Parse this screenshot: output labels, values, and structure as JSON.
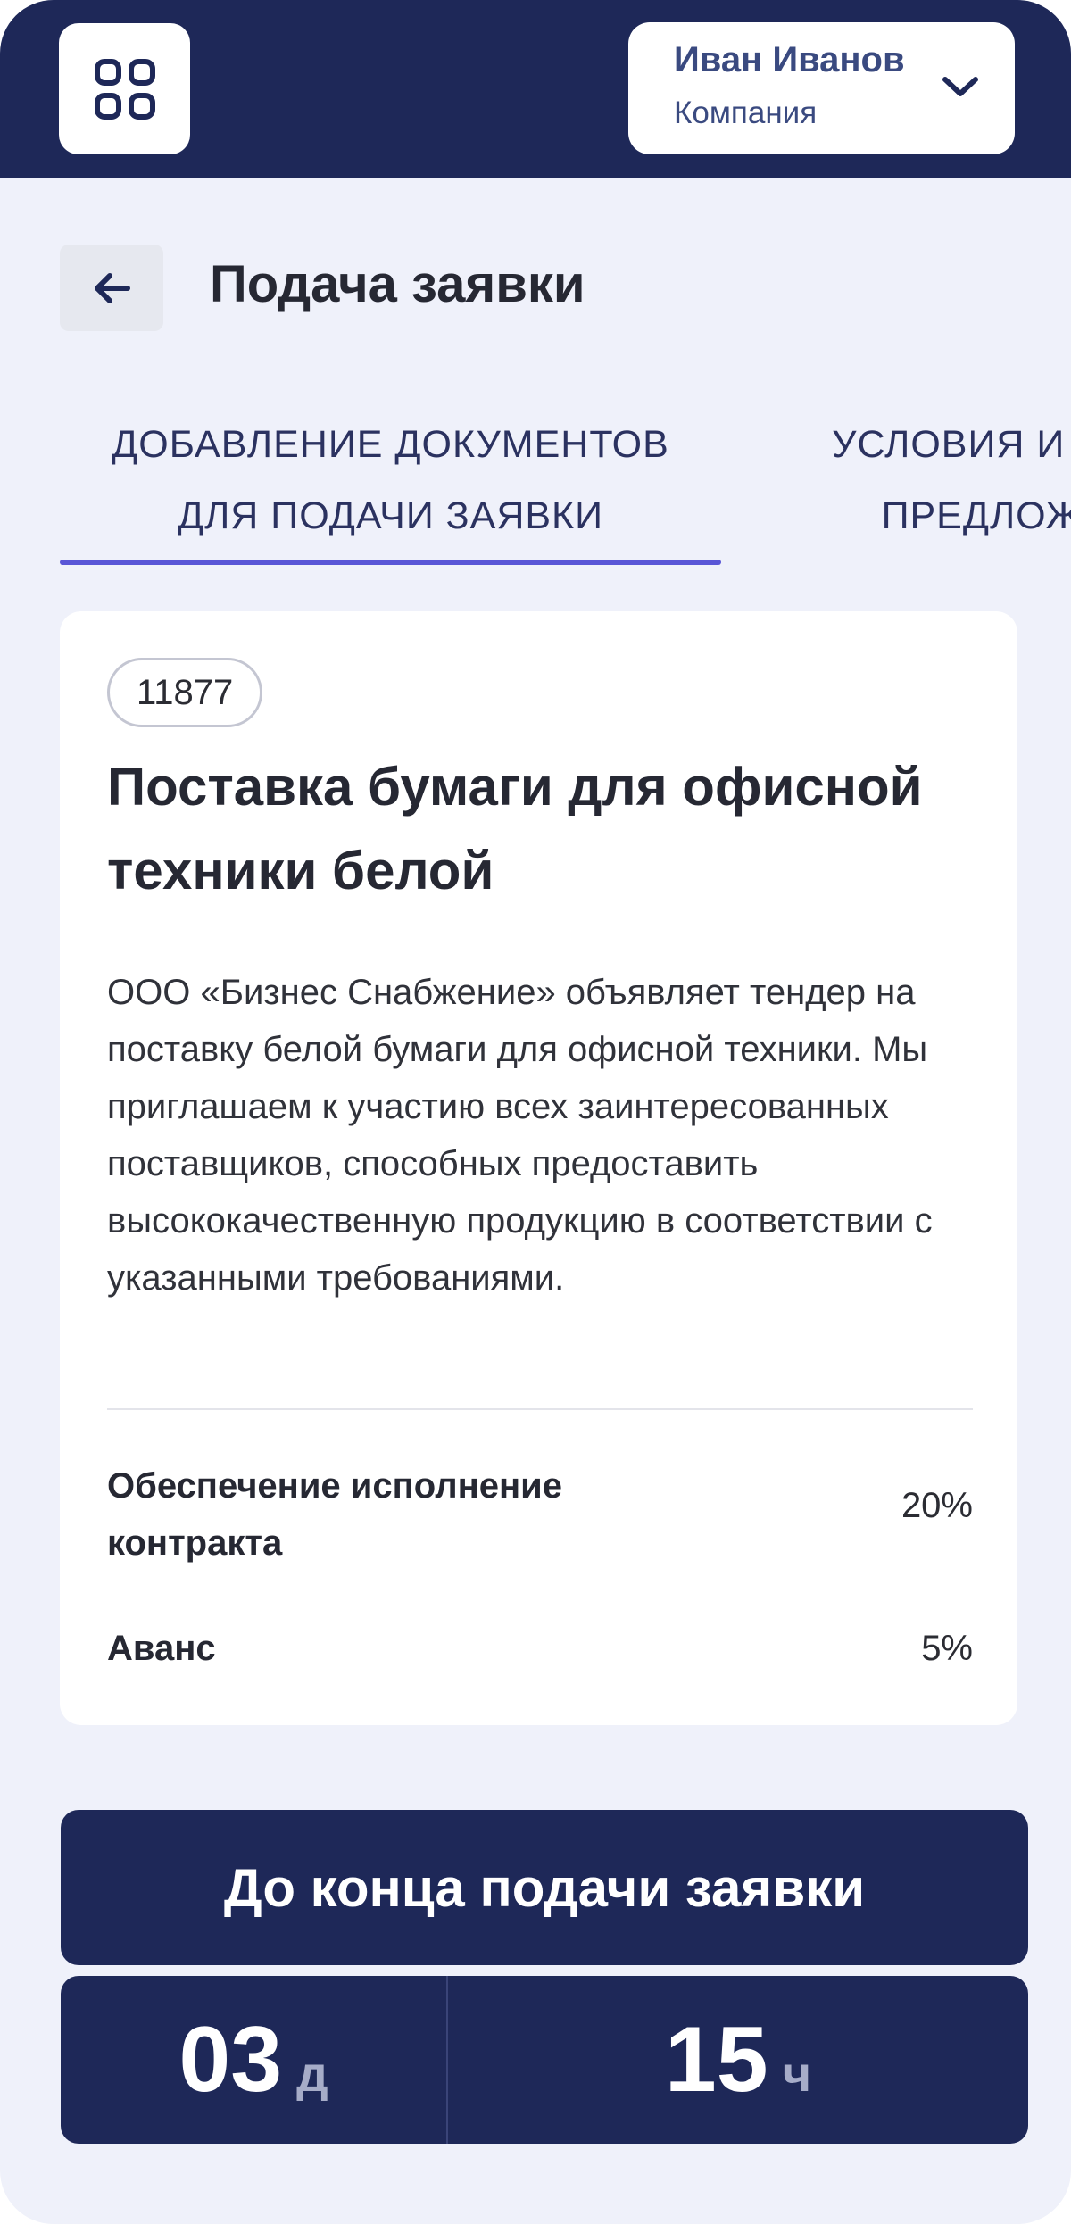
{
  "header": {
    "user": {
      "name": "Иван Иванов",
      "company": "Компания"
    }
  },
  "page": {
    "title": "Подача заявки"
  },
  "tabs": [
    {
      "label_line1": "ДОБАВЛЕНИЕ ДОКУМЕНТОВ",
      "label_line2": "ДЛЯ ПОДАЧИ ЗАЯВКИ",
      "active": true
    },
    {
      "label_line1": "УСЛОВИЯ И ПА",
      "label_line2": "ПРЕДЛОЖ",
      "active": false
    }
  ],
  "tender": {
    "id": "11877",
    "title": "Поставка бумаги для офисной техники белой",
    "description": "ООО «Бизнес Снабжение» объявляет тендер на поставку белой бумаги для офисной техники. Мы приглашаем к участию всех заинтересованных поставщиков, способных предоставить высококачественную продукцию в соответствии с указанными требованиями.",
    "details": [
      {
        "label": "Обеспечение исполнение контракта",
        "value": "20%"
      },
      {
        "label": "Аванс",
        "value": "5%"
      }
    ]
  },
  "deadline": {
    "label": "До конца подачи заявки",
    "days": {
      "value": "03",
      "unit": "д"
    },
    "hours": {
      "value": "15",
      "unit": "ч"
    }
  },
  "colors": {
    "header_bg": "#1e2858",
    "page_bg": "#eff1fa",
    "accent": "#5956d6",
    "card_bg": "#ffffff"
  },
  "icons": {
    "menu": "grid-icon",
    "user_dropdown": "chevron-down-icon",
    "back": "arrow-left-icon"
  }
}
